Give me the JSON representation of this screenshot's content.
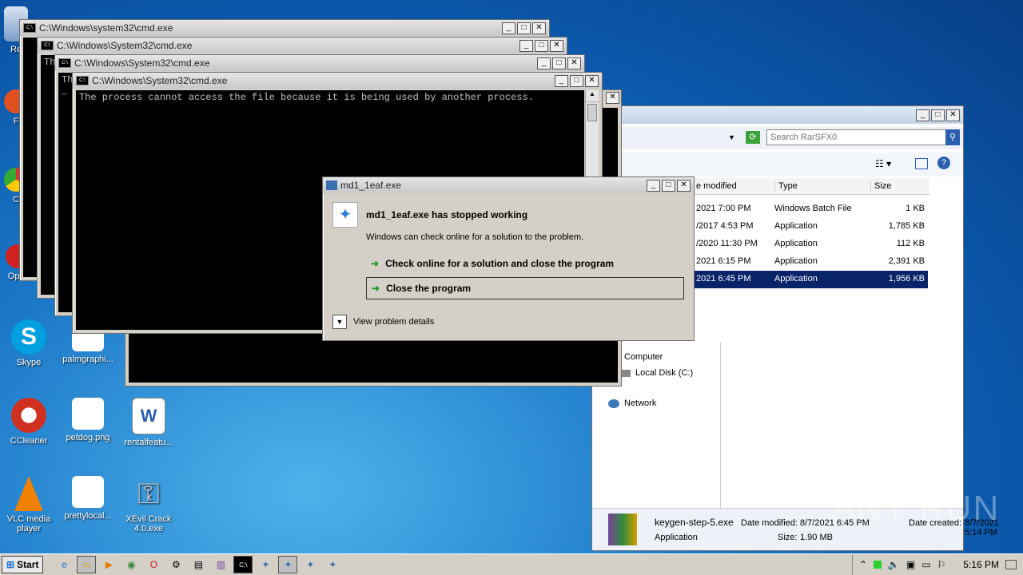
{
  "desktop_icons": [
    {
      "label": "Re",
      "color": "#7a9cc8"
    },
    {
      "label": "F",
      "color": "#e05020"
    },
    {
      "label": "C",
      "color": "#3c8c3c"
    },
    {
      "label": "Oper",
      "color": "#d02020"
    },
    {
      "label": "Skype",
      "color": "#00a0e0"
    },
    {
      "label": "palmgraphi...",
      "color": "#ffffff"
    },
    {
      "label": "CCleaner",
      "color": "#d03020"
    },
    {
      "label": "petdog.png",
      "color": "#ffffff"
    },
    {
      "label": "rentalfeatu...",
      "color": "#2b5fb0"
    },
    {
      "label": "VLC media player",
      "color": "#f08000"
    },
    {
      "label": "prettylocal...",
      "color": "#ffffff"
    },
    {
      "label": "XEvil Crack 4.0.exe",
      "color": "#b0b0b0"
    }
  ],
  "cmd_windows": [
    {
      "title": "C:\\Windows\\system32\\cmd.exe",
      "text": ""
    },
    {
      "title": "C:\\Windows\\System32\\cmd.exe",
      "text": "Th"
    },
    {
      "title": "C:\\Windows\\System32\\cmd.exe",
      "text": "Th\n_"
    },
    {
      "title": "C:\\Windows\\System32\\cmd.exe",
      "text": "The process cannot access the file because it is being used by another process."
    }
  ],
  "explorer": {
    "search_placeholder": "Search RarSFX0",
    "columns": {
      "date": "e modified",
      "type": "Type",
      "size": "Size"
    },
    "rows": [
      {
        "date": "2021 7:00 PM",
        "type": "Windows Batch File",
        "size": "1 KB"
      },
      {
        "date": "/2017 4:53 PM",
        "type": "Application",
        "size": "1,785 KB"
      },
      {
        "date": "/2020 11:30 PM",
        "type": "Application",
        "size": "112 KB"
      },
      {
        "date": "2021 6:15 PM",
        "type": "Application",
        "size": "2,391 KB"
      },
      {
        "date": "2021 6:45 PM",
        "type": "Application",
        "size": "1,956 KB"
      }
    ],
    "nav": {
      "computer": "Computer",
      "local_disk": "Local Disk (C:)",
      "network": "Network"
    },
    "details": {
      "name": "keygen-step-5.exe",
      "kind": "Application",
      "modified_label": "Date modified:",
      "modified": "8/7/2021 6:45 PM",
      "size_label": "Size:",
      "size": "1.90 MB",
      "created_label": "Date created:",
      "created": "8/7/2021 5:14 PM"
    }
  },
  "dialog": {
    "title": "md1_1eaf.exe",
    "heading": "md1_1eaf.exe has stopped working",
    "subtext": "Windows can check online for a solution to the problem.",
    "option_check": "Check online for a solution and close the program",
    "option_close": "Close the program",
    "details": "View problem details"
  },
  "taskbar": {
    "start": "Start",
    "clock": "5:16 PM"
  },
  "watermark": "ANY RUN"
}
